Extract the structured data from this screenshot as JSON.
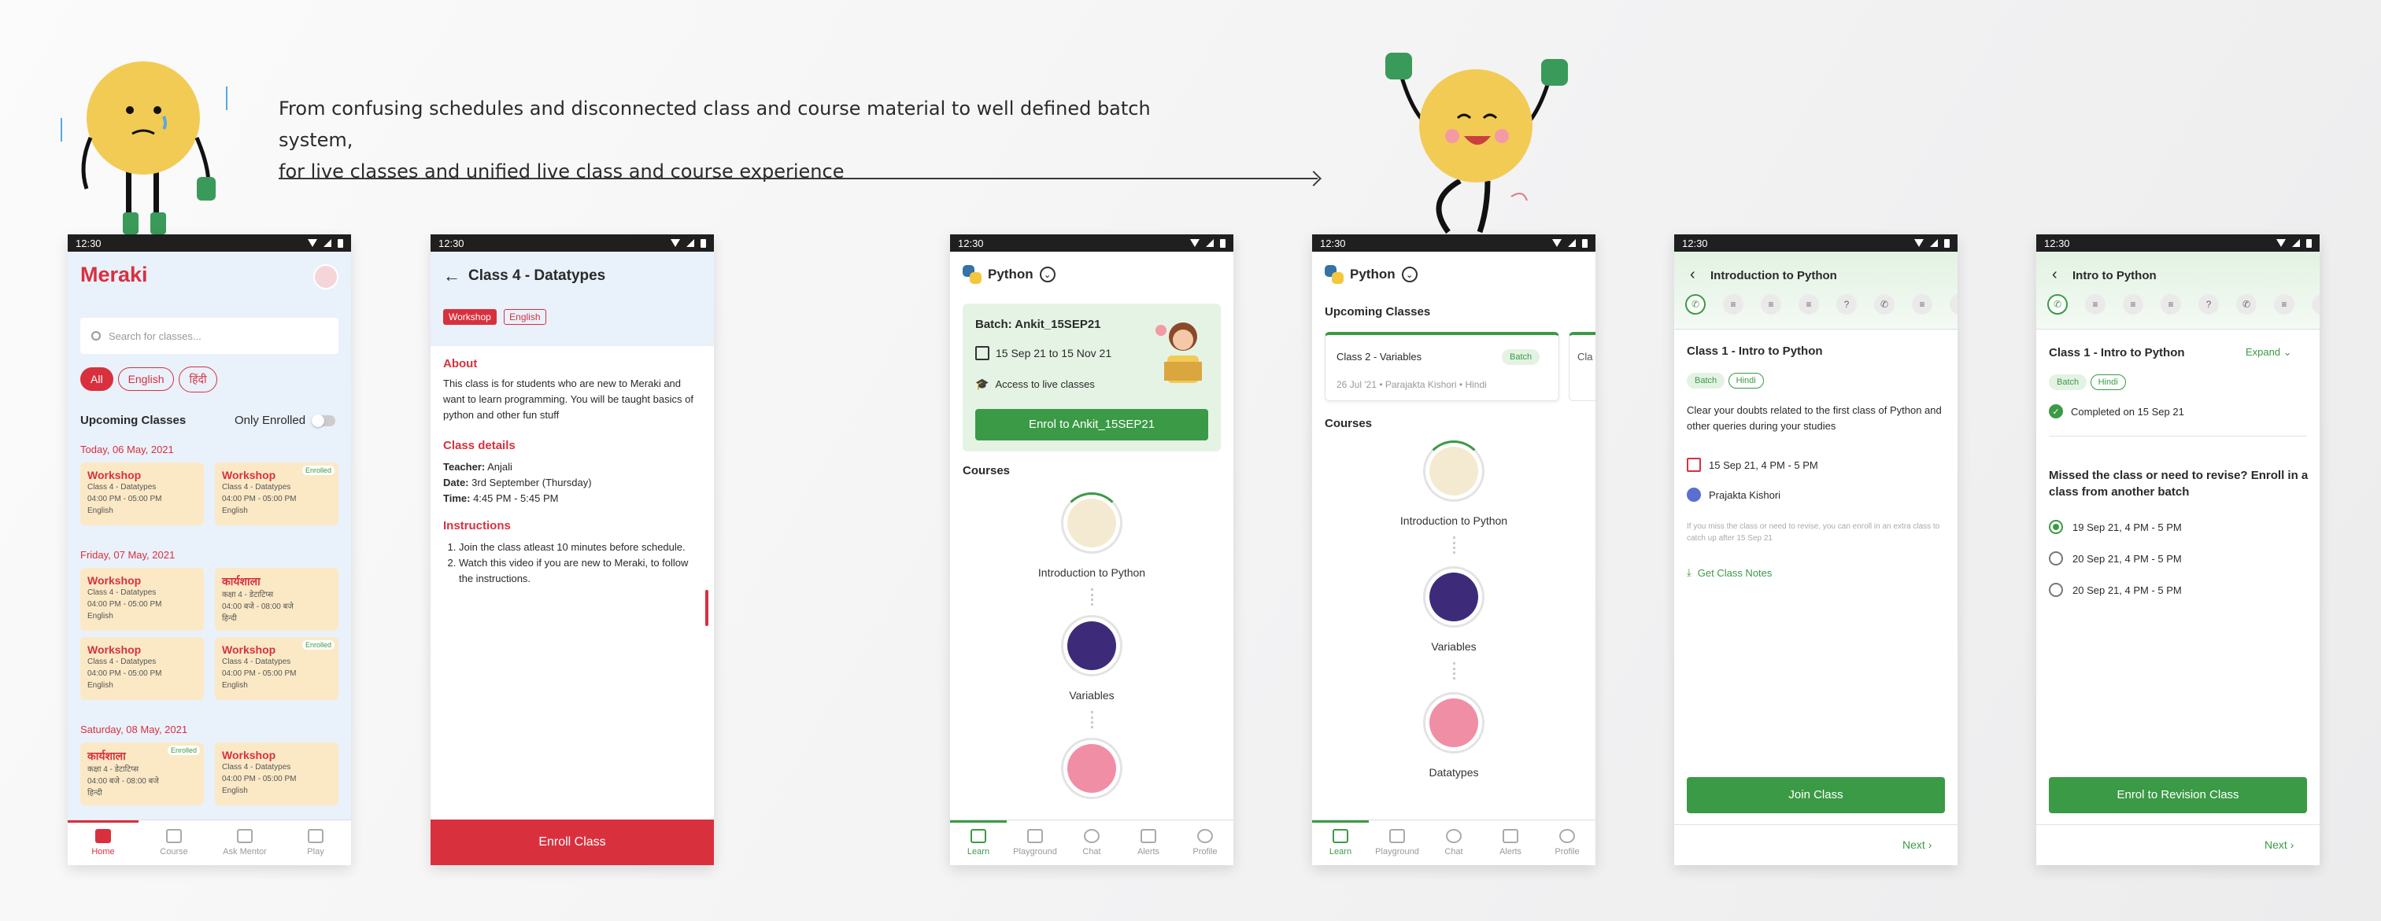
{
  "headline": {
    "line1": "From confusing schedules and disconnected class and course material to well defined batch system,",
    "line2": "for live classes and unified live class and course experience"
  },
  "status_time": "12:30",
  "colors": {
    "brand_red": "#d9303e",
    "brand_green": "#3b9a45",
    "card_bg": "#fbe9c6"
  },
  "screen1": {
    "logo": "Meraki",
    "search_placeholder": "Search for classes...",
    "filters": [
      "All",
      "English",
      "हिंदी"
    ],
    "section_title": "Upcoming Classes",
    "only_enrolled": "Only Enrolled",
    "days": [
      {
        "label": "Today, 06 May, 2021",
        "cards": [
          {
            "title": "Workshop",
            "l1": "Class 4 - Datatypes",
            "l2": "04:00 PM - 05:00 PM",
            "l3": "English",
            "badge": ""
          },
          {
            "title": "Workshop",
            "l1": "Class 4 - Datatypes",
            "l2": "04:00 PM - 05:00 PM",
            "l3": "English",
            "badge": "Enrolled"
          }
        ]
      },
      {
        "label": "Friday, 07 May, 2021",
        "cards": [
          {
            "title": "Workshop",
            "l1": "Class 4 - Datatypes",
            "l2": "04:00 PM - 05:00 PM",
            "l3": "English",
            "badge": ""
          },
          {
            "title": "कार्यशाला",
            "l1": "कक्षा 4 - डेटाटिप्स",
            "l2": "04:00 बजे - 08:00 बजे",
            "l3": "हिन्दी",
            "badge": ""
          },
          {
            "title": "Workshop",
            "l1": "Class 4 - Datatypes",
            "l2": "04:00 PM - 05:00 PM",
            "l3": "English",
            "badge": ""
          },
          {
            "title": "Workshop",
            "l1": "Class 4 - Datatypes",
            "l2": "04:00 PM - 05:00 PM",
            "l3": "English",
            "badge": "Enrolled"
          }
        ]
      },
      {
        "label": "Saturday, 08 May, 2021",
        "cards": [
          {
            "title": "कार्यशाला",
            "l1": "कक्षा 4 - डेटाटिप्स",
            "l2": "04:00 बजे - 08:00 बजे",
            "l3": "हिन्दी",
            "badge": "Enrolled"
          },
          {
            "title": "Workshop",
            "l1": "Class 4 - Datatypes",
            "l2": "04:00 PM - 05:00 PM",
            "l3": "English",
            "badge": ""
          }
        ]
      }
    ],
    "nav": [
      "Home",
      "Course",
      "Ask Mentor",
      "Play"
    ]
  },
  "screen2": {
    "title": "Class 4 - Datatypes",
    "tag1": "Workshop",
    "tag2": "English",
    "about_h": "About",
    "about": "This class is for students who are new to Meraki and want to learn programming. You will be taught basics of python and other fun stuff",
    "details_h": "Class details",
    "teacher_k": "Teacher:",
    "teacher_v": "Anjali",
    "date_k": "Date:",
    "date_v": "3rd September (Thursday)",
    "time_k": "Time:",
    "time_v": "4:45 PM - 5:45 PM",
    "instr_h": "Instructions",
    "instr1": "Join the class atleast 10 minutes before schedule.",
    "instr2": "Watch this video if you are new to Meraki, to follow the instructions.",
    "cta": "Enroll Class"
  },
  "screen3": {
    "title": "Python",
    "batch": "Batch: Ankit_15SEP21",
    "dates": "15 Sep 21 to 15 Nov 21",
    "access": "Access to live classes",
    "cta": "Enrol to Ankit_15SEP21",
    "courses_h": "Courses",
    "course1": "Introduction to Python",
    "course2": "Variables",
    "nav": [
      "Learn",
      "Playground",
      "Chat",
      "Alerts",
      "Profile"
    ]
  },
  "screen4": {
    "title": "Python",
    "upcoming_h": "Upcoming Classes",
    "card_title": "Class 2 - Variables",
    "card_badge": "Batch",
    "card_meta": "26 Jul '21 • Parajakta Kishori • Hindi",
    "card2_stub": "Cla",
    "courses_h": "Courses",
    "course1": "Introduction to Python",
    "course2": "Variables",
    "course3": "Datatypes",
    "nav": [
      "Learn",
      "Playground",
      "Chat",
      "Alerts",
      "Profile"
    ]
  },
  "screen5": {
    "header": "Introduction to Python",
    "class_title": "Class 1 - Intro to Python",
    "tag1": "Batch",
    "tag2": "Hindi",
    "desc": "Clear your doubts related to the first class of Python and other queries during your studies",
    "datetime": "15 Sep 21, 4 PM - 5 PM",
    "teacher": "Prajakta Kishori",
    "note": "If you miss the class or need to revise, you can enroll in an extra class to catch up after 15 Sep 21",
    "notes_link": "Get Class Notes",
    "cta": "Join Class",
    "next": "Next"
  },
  "screen6": {
    "header": "Intro to Python",
    "class_title": "Class 1 - Intro to Python",
    "expand": "Expand",
    "tag1": "Batch",
    "tag2": "Hindi",
    "completed": "Completed on 15 Sep 21",
    "question": "Missed the class or need to revise? Enroll in a class from another batch",
    "options": [
      "19 Sep 21, 4 PM - 5 PM",
      "20 Sep 21, 4 PM - 5 PM",
      "20 Sep 21, 4 PM - 5 PM"
    ],
    "selected_option": 0,
    "cta": "Enrol to Revision Class",
    "next": "Next"
  }
}
